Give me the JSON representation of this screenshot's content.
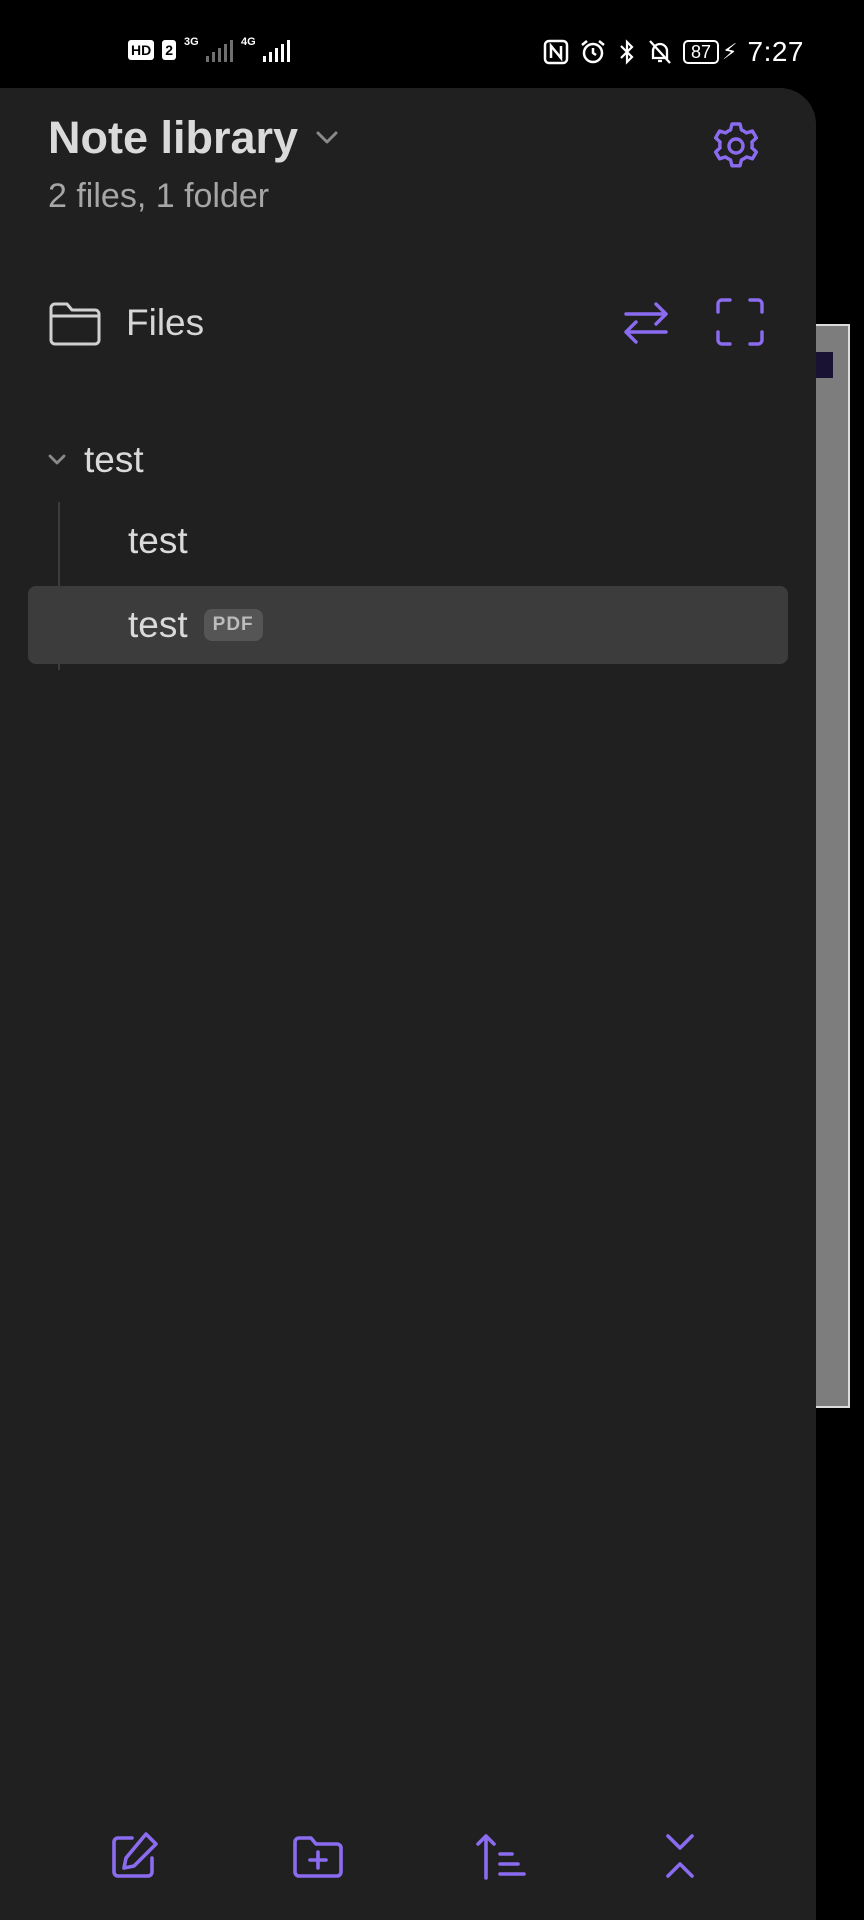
{
  "status_bar": {
    "hd_label": "HD",
    "sim_label": "2",
    "net1_label": "3G",
    "net2_label": "4G",
    "battery_level": "87",
    "time": "7:27"
  },
  "drawer": {
    "title": "Note library",
    "subtitle": "2 files, 1 folder",
    "section_label": "Files",
    "tree": {
      "folder_name": "test",
      "files": [
        {
          "name": "test",
          "badge": ""
        },
        {
          "name": "test",
          "badge": "PDF"
        }
      ]
    }
  },
  "colors": {
    "accent": "#8b6cf0",
    "panel_bg": "#202020",
    "text_primary": "#dadada",
    "text_secondary": "#a6a6a6",
    "active_row": "#3c3c3c"
  }
}
